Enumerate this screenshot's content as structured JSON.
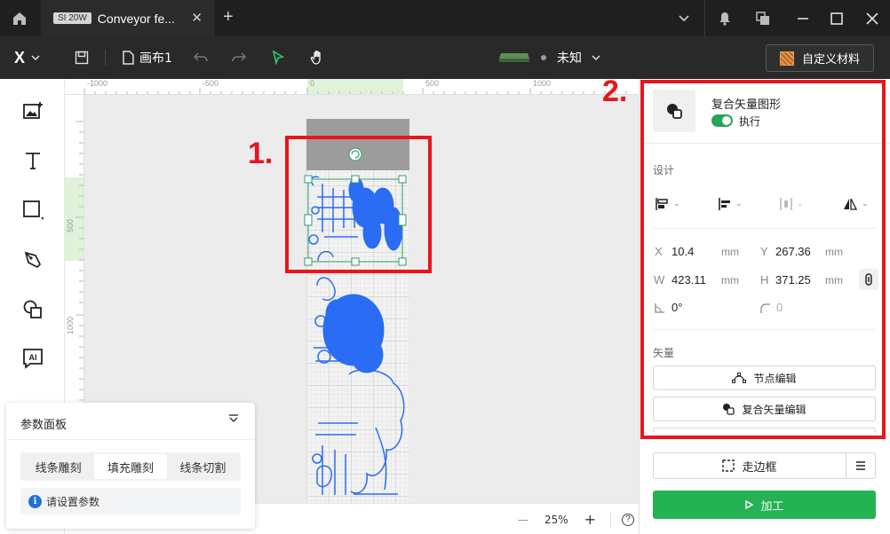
{
  "titlebar": {
    "tab_badge": "SI 20W",
    "tab_title": "Conveyor fe...",
    "tab_close": "✕",
    "tab_add": "+",
    "icons": [
      "home-icon",
      "chevron-down-icon",
      "bell-icon",
      "windows-icon",
      "minimize-icon",
      "maximize-icon",
      "close-icon"
    ]
  },
  "toolbar": {
    "logo": "X",
    "canvas_name": "画布1",
    "device_status": "未知",
    "material_label": "自定义材料",
    "colors": {
      "select_tool": "#2ecc71",
      "status_dot": "#9a9a9a"
    }
  },
  "leftbar": {
    "tools": [
      "image-tool-icon",
      "text-tool-icon",
      "shape-tool-icon",
      "pen-tool-icon",
      "boolean-tool-icon",
      "ai-tool-icon"
    ]
  },
  "ruler": {
    "top_labels": [
      "-1000",
      "-500",
      "0",
      "500",
      "1000"
    ],
    "left_labels": [
      "500",
      "1000"
    ]
  },
  "param_panel": {
    "title": "参数面板",
    "tabs": [
      "线条雕刻",
      "填充雕刻",
      "线条切割"
    ],
    "active_tab": 1,
    "info_text": "请设置参数",
    "info_mark": "i"
  },
  "bottombar": {
    "zoom_minus": "—",
    "zoom_value": "25%",
    "zoom_plus": "+",
    "help": "?"
  },
  "right_panel": {
    "object_name": "复合矢量图形",
    "toggle_label": "执行",
    "toggle_on": true,
    "section_design": "设计",
    "x_label": "X",
    "x_value": "10.4",
    "x_unit": "mm",
    "y_label": "Y",
    "y_value": "267.36",
    "y_unit": "mm",
    "w_label": "W",
    "w_value": "423.11",
    "w_unit": "mm",
    "h_label": "H",
    "h_value": "371.25",
    "h_unit": "mm",
    "rotation": "0°",
    "corner": "0",
    "section_vector": "矢量",
    "node_edit": "节点编辑",
    "compound_edit": "复合矢量编辑",
    "frame_label": "走边框",
    "process_label": "加工",
    "colors": {
      "process": "#25b254",
      "toggle": "#25a55a"
    }
  },
  "annotations": {
    "label_1": "1.",
    "label_2": "2.",
    "color": "#e8151b"
  }
}
